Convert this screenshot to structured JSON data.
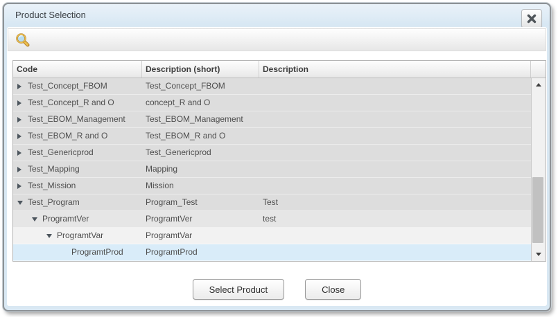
{
  "window": {
    "title": "Product Selection"
  },
  "toolbar": {
    "search_icon": "magnifier"
  },
  "grid": {
    "columns": [
      {
        "key": "code",
        "label": "Code"
      },
      {
        "key": "desc_short",
        "label": "Description (short)"
      },
      {
        "key": "desc",
        "label": "Description"
      }
    ],
    "rows": [
      {
        "code": "Test_Concept_FBOM",
        "desc_short": "Test_Concept_FBOM",
        "desc": "",
        "level": 0,
        "has_children": true,
        "expanded": false,
        "selected": false,
        "tone": "base"
      },
      {
        "code": "Test_Concept_R and O",
        "desc_short": "concept_R and O",
        "desc": "",
        "level": 0,
        "has_children": true,
        "expanded": false,
        "selected": false,
        "tone": "base"
      },
      {
        "code": "Test_EBOM_Management",
        "desc_short": "Test_EBOM_Management",
        "desc": "",
        "level": 0,
        "has_children": true,
        "expanded": false,
        "selected": false,
        "tone": "base"
      },
      {
        "code": "Test_EBOM_R and O",
        "desc_short": "Test_EBOM_R and O",
        "desc": "",
        "level": 0,
        "has_children": true,
        "expanded": false,
        "selected": false,
        "tone": "base"
      },
      {
        "code": "Test_Genericprod",
        "desc_short": "Test_Genericprod",
        "desc": "",
        "level": 0,
        "has_children": true,
        "expanded": false,
        "selected": false,
        "tone": "base"
      },
      {
        "code": "Test_Mapping",
        "desc_short": "Mapping",
        "desc": "",
        "level": 0,
        "has_children": true,
        "expanded": false,
        "selected": false,
        "tone": "base"
      },
      {
        "code": "Test_Mission",
        "desc_short": "Mission",
        "desc": "",
        "level": 0,
        "has_children": true,
        "expanded": false,
        "selected": false,
        "tone": "base"
      },
      {
        "code": "Test_Program",
        "desc_short": "Program_Test",
        "desc": "Test",
        "level": 0,
        "has_children": true,
        "expanded": true,
        "selected": false,
        "tone": "base"
      },
      {
        "code": "ProgramtVer",
        "desc_short": "ProgramtVer",
        "desc": "test",
        "level": 1,
        "has_children": true,
        "expanded": true,
        "selected": false,
        "tone": "mid"
      },
      {
        "code": "ProgramtVar",
        "desc_short": "ProgramtVar",
        "desc": "",
        "level": 2,
        "has_children": true,
        "expanded": true,
        "selected": false,
        "tone": "light"
      },
      {
        "code": "ProgramtProd",
        "desc_short": "ProgramtProd",
        "desc": "",
        "level": 3,
        "has_children": false,
        "expanded": false,
        "selected": true,
        "tone": "selected"
      }
    ]
  },
  "scrollbar": {
    "thumb_top_pct": 55,
    "thumb_height_pct": 42
  },
  "footer": {
    "select_label": "Select Product",
    "close_label": "Close"
  },
  "colors": {
    "frame": "#d9e8f3",
    "row": "#dddddd",
    "row_mid": "#e6e6e6",
    "row_light": "#f2f2f2",
    "selection": "#d9ecf9",
    "search_handle": "#d9a441",
    "search_lens": "#b8ddf0"
  }
}
